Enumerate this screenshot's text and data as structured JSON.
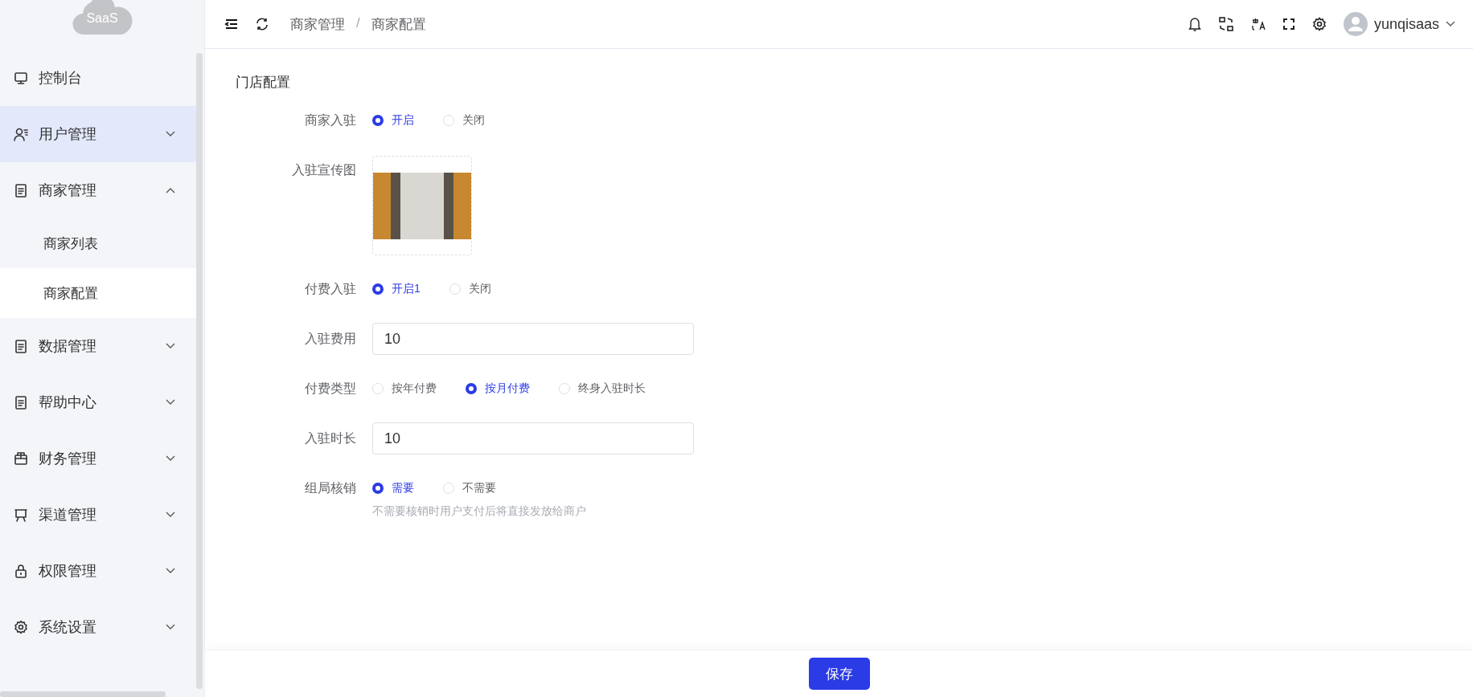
{
  "sidebar": {
    "logo": "SaaS",
    "items": [
      {
        "label": "控制台",
        "hovered": false
      },
      {
        "label": "用户管理",
        "expanded": false,
        "hovered": true
      },
      {
        "label": "商家管理",
        "expanded": true,
        "hovered": false,
        "children": [
          {
            "label": "商家列表",
            "selected": false
          },
          {
            "label": "商家配置",
            "selected": true
          }
        ]
      },
      {
        "label": "数据管理",
        "expanded": false,
        "hovered": false
      },
      {
        "label": "帮助中心",
        "expanded": false,
        "hovered": false
      },
      {
        "label": "财务管理",
        "expanded": false,
        "hovered": false
      },
      {
        "label": "渠道管理",
        "expanded": false,
        "hovered": false
      },
      {
        "label": "权限管理",
        "expanded": false,
        "hovered": false
      },
      {
        "label": "系统设置",
        "expanded": false,
        "hovered": false
      }
    ]
  },
  "header": {
    "breadcrumb": [
      "商家管理",
      "商家配置"
    ],
    "separator": "/",
    "user": "yunqisaas"
  },
  "form": {
    "title": "门店配置",
    "rows": [
      {
        "kind": "radio",
        "label": "商家入驻",
        "options": [
          {
            "label": "开启",
            "selected": true
          },
          {
            "label": "关闭",
            "selected": false
          }
        ]
      },
      {
        "kind": "image",
        "label": "入驻宣传图"
      },
      {
        "kind": "radio",
        "label": "付费入驻",
        "options": [
          {
            "label": "开启1",
            "selected": true
          },
          {
            "label": "关闭",
            "selected": false
          }
        ]
      },
      {
        "kind": "input",
        "label": "入驻费用",
        "value": "10"
      },
      {
        "kind": "radio",
        "label": "付费类型",
        "options": [
          {
            "label": "按年付费",
            "selected": false
          },
          {
            "label": "按月付费",
            "selected": true
          },
          {
            "label": "终身入驻时长",
            "selected": false
          }
        ]
      },
      {
        "kind": "input",
        "label": "入驻时长",
        "value": "10"
      },
      {
        "kind": "radio",
        "label": "组局核销",
        "options": [
          {
            "label": "需要",
            "selected": true
          },
          {
            "label": "不需要",
            "selected": false
          }
        ],
        "hint": "不需要核销时用户支付后将直接发放给商户"
      }
    ]
  },
  "footer": {
    "button": "保存"
  }
}
